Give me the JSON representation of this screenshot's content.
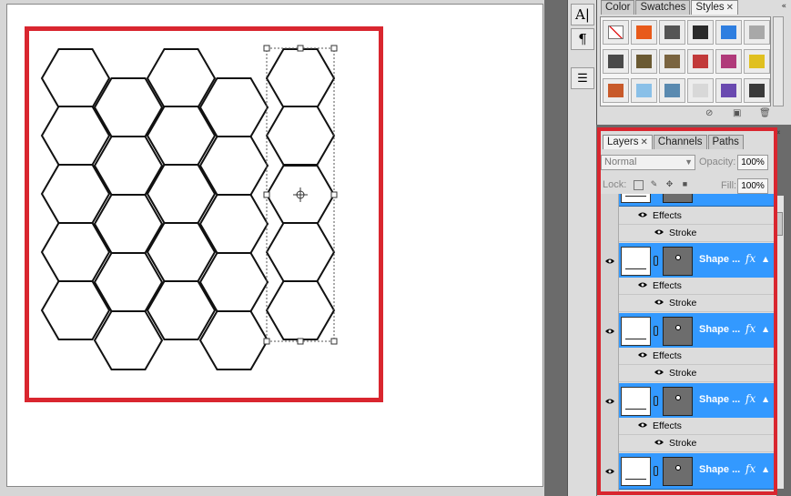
{
  "styles_panel": {
    "tabs": [
      {
        "label": "Color",
        "active": false,
        "closable": false
      },
      {
        "label": "Swatches",
        "active": false,
        "closable": false
      },
      {
        "label": "Styles",
        "active": true,
        "closable": true
      }
    ],
    "close_glyph": "«",
    "swatches": [
      [
        "#ffffff",
        "#e85a1a",
        "#555555",
        "#2a2a2a",
        "#2e7ee0",
        "#a8a8a8"
      ],
      [
        "#4a4a4a",
        "#6b5a33",
        "#7a6440",
        "#c23a3a",
        "#b03a7a",
        "#e0c020"
      ],
      [
        "#c85a2a",
        "#8ac0e8",
        "#5a8ab0",
        "#d8d8d8",
        "#6a4ab0",
        "#3a3a3a"
      ]
    ],
    "footer_icons": [
      "clear-style-icon",
      "new-style-icon",
      "delete-style-icon"
    ]
  },
  "toolstrip": {
    "buttons": [
      {
        "name": "character-icon",
        "glyph": "A|"
      },
      {
        "name": "paragraph-icon",
        "glyph": "¶"
      },
      {
        "name": "layer-comps-icon",
        "glyph": "☰"
      }
    ]
  },
  "layers_panel": {
    "tabs": [
      {
        "label": "Layers",
        "active": true,
        "closable": true
      },
      {
        "label": "Channels",
        "active": false,
        "closable": false
      },
      {
        "label": "Paths",
        "active": false,
        "closable": false
      }
    ],
    "close_glyph": "«",
    "blend_mode": "Normal",
    "opacity_label": "Opacity:",
    "opacity_value": "100%",
    "lock_label": "Lock:",
    "fill_label": "Fill:",
    "fill_value": "100%",
    "effects_label": "Effects",
    "stroke_label": "Stroke",
    "layers": [
      {
        "name": "Shape ...",
        "fx": "fx"
      },
      {
        "name": "Shape ...",
        "fx": "fx"
      },
      {
        "name": "Shape ...",
        "fx": "fx"
      },
      {
        "name": "Shape ...",
        "fx": "fx"
      }
    ]
  },
  "colors": {
    "highlight": "#d9262f",
    "selection": "#3399ff"
  }
}
